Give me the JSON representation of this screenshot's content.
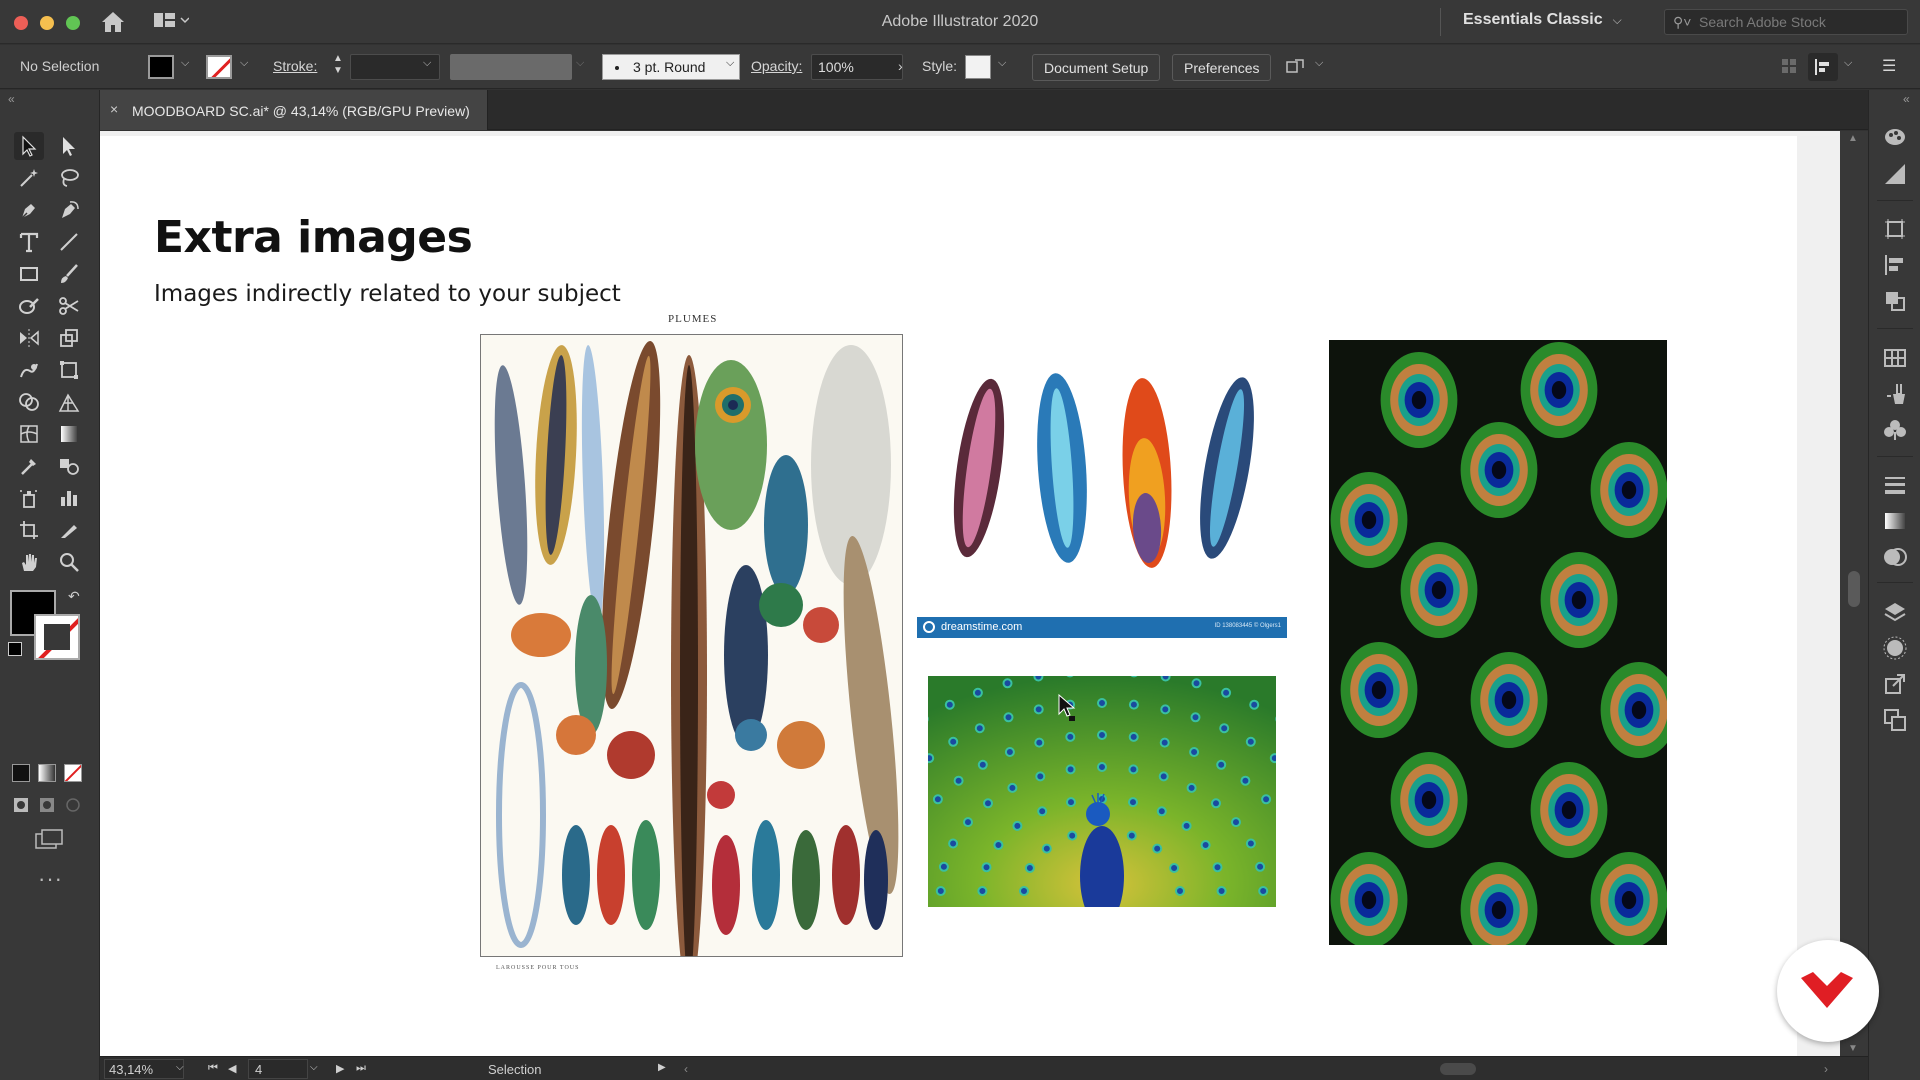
{
  "app": {
    "window_title": "Adobe Illustrator 2020",
    "workspace": "Essentials Classic",
    "stock_search_placeholder": "Search Adobe Stock"
  },
  "control_bar": {
    "selection_state": "No Selection",
    "stroke_label": "Stroke:",
    "stroke_weight": "",
    "brush_profile": "3 pt. Round",
    "opacity_label": "Opacity:",
    "opacity_value": "100%",
    "style_label": "Style:",
    "document_setup_label": "Document Setup",
    "preferences_label": "Preferences"
  },
  "document_tab": {
    "title": "MOODBOARD SC.ai* @ 43,14% (RGB/GPU Preview)",
    "close_glyph": "×"
  },
  "artboard": {
    "heading": "Extra images",
    "subheading": "Images indirectly related to your subject",
    "images": [
      {
        "name": "vintage-feather-plate",
        "caption_top": "PLUMES",
        "caption_bottom": "LAROUSSE POUR TOUS"
      },
      {
        "name": "four-watercolor-feathers",
        "watermark_site": "dreamstime.com",
        "watermark_id": "ID 138083445 © Olgers1"
      },
      {
        "name": "peacock-displaying-feathers"
      },
      {
        "name": "peacock-feather-closeup"
      }
    ]
  },
  "status_bar": {
    "zoom": "43,14%",
    "artboard_number": "4",
    "current_tool": "Selection"
  },
  "colors": {
    "fill": "#000000",
    "stroke": "none",
    "chrome_bg": "#383838",
    "canvas_bg": "#f0f0f0",
    "badge_accent": "#e01e24"
  },
  "icons": {
    "toolbar_left": [
      "selection-tool",
      "direct-selection-tool",
      "magic-wand-tool",
      "lasso-tool",
      "pen-tool",
      "curvature-tool",
      "type-tool",
      "line-segment-tool",
      "rectangle-tool",
      "paintbrush-tool",
      "shaper-tool",
      "scissors-tool",
      "reflect-tool",
      "scale-tool",
      "warp-tool",
      "free-transform-tool",
      "shape-builder-tool",
      "perspective-grid-tool",
      "mesh-tool",
      "gradient-tool",
      "eyedropper-tool",
      "blend-tool",
      "symbol-sprayer-tool",
      "column-graph-tool",
      "artboard-tool",
      "slice-tool",
      "hand-tool",
      "zoom-tool"
    ],
    "panel_right": [
      "color-panel",
      "color-guide-panel",
      "transform-panel",
      "align-panel",
      "pathfinder-panel",
      "swatches-panel",
      "brushes-panel",
      "symbols-panel",
      "stroke-panel",
      "gradient-panel",
      "transparency-panel",
      "layers-panel",
      "appearance-panel",
      "export-panel",
      "artboards-panel"
    ]
  }
}
